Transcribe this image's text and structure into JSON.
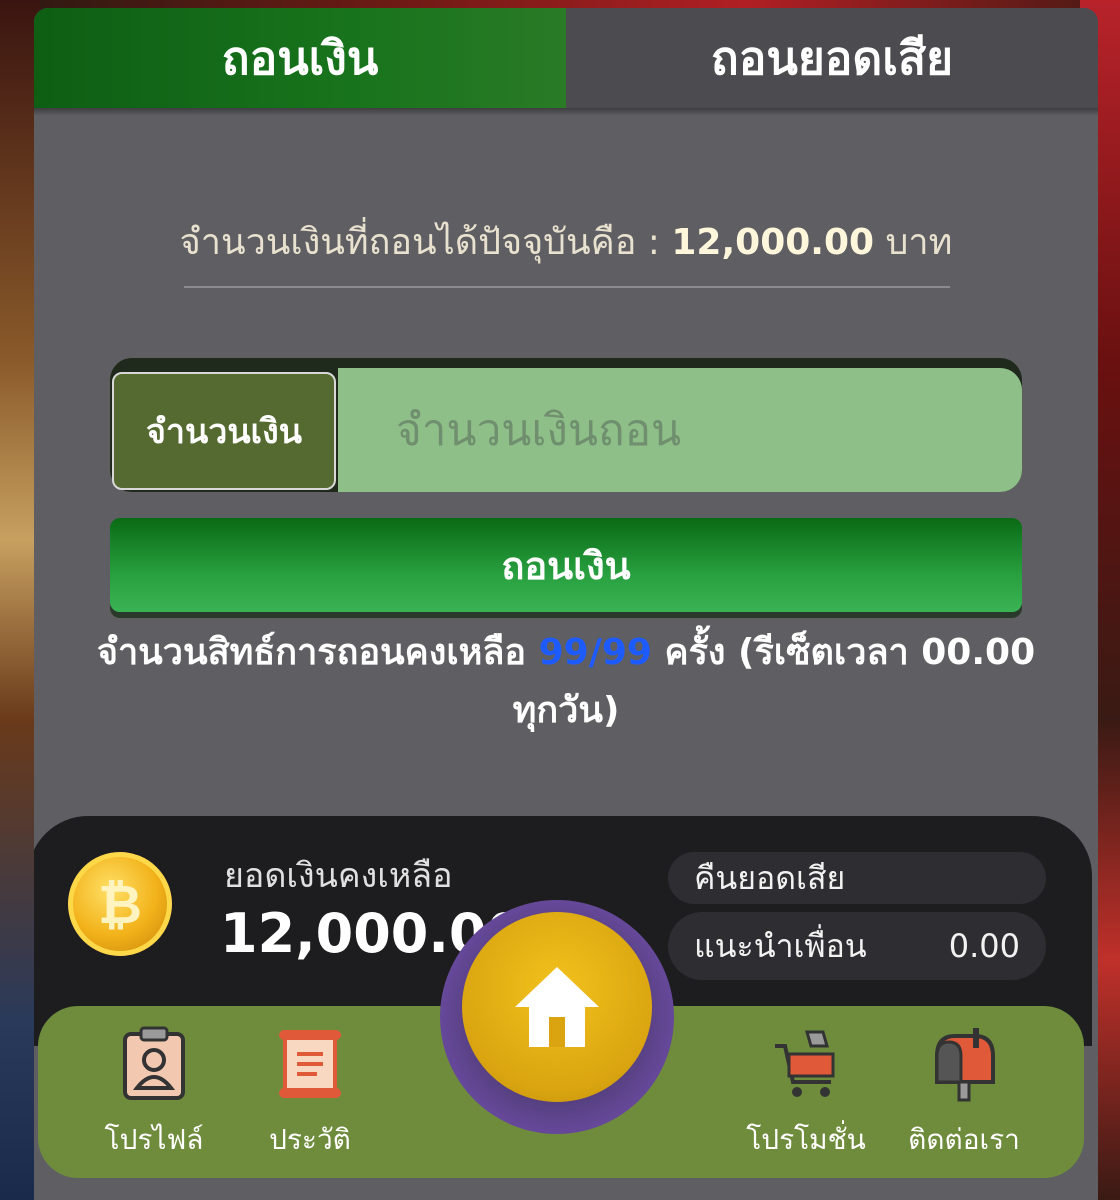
{
  "tabs": [
    {
      "label": "ถอนเงิน",
      "active": true
    },
    {
      "label": "ถอนยอดเสีย",
      "active": false
    }
  ],
  "available": {
    "prefix": "จำนวนเงินที่ถอนได้ปัจจุบันคือ :",
    "amount": "12,000.00",
    "unit": "บาท"
  },
  "withdraw_form": {
    "label": "จำนวนเงิน",
    "placeholder": "จำนวนเงินถอน",
    "button_label": "ถอนเงิน"
  },
  "quota": {
    "prefix": "จำนวนสิทธ์การถอนคงเหลือ",
    "count": "99/99",
    "suffix": "ครั้ง (รีเซ็ตเวลา 00.00 ทุกวัน)"
  },
  "wallet": {
    "coin_icon": "bitcoin-coin-icon",
    "balance_label": "ยอดเงินคงเหลือ",
    "balance_value": "12,000.00",
    "rebate_label": "คืนยอดเสีย",
    "referral_label": "แนะนำเพื่อน",
    "referral_value": "0.00"
  },
  "nav": {
    "profile": "โปรไฟล์",
    "history": "ประวัติ",
    "promotion": "โปรโมชั่น",
    "contact": "ติดต่อเรา",
    "home_icon": "home-icon"
  },
  "colors": {
    "accent_green": "#18741c",
    "nav_green": "#6e8c3c",
    "quota_blue": "#1e5bff",
    "coin_gold": "#f2b21a"
  }
}
